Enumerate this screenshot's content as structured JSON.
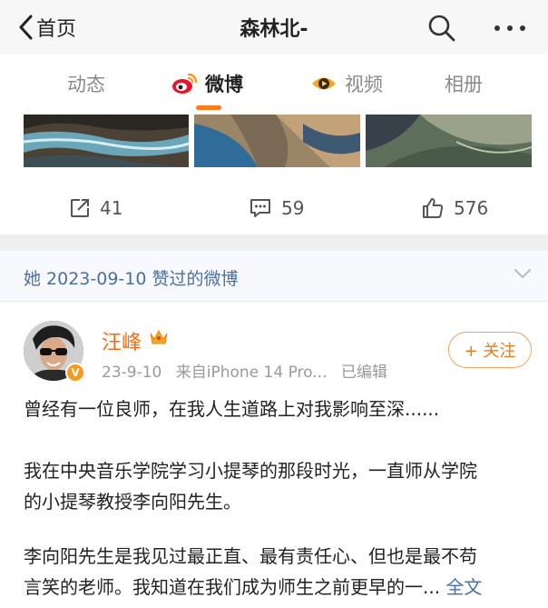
{
  "nav": {
    "back_label": "首页",
    "title": "森林北-"
  },
  "tabs": [
    {
      "label": "动态",
      "active": false
    },
    {
      "label": "微博",
      "active": true
    },
    {
      "label": "视频",
      "active": false
    },
    {
      "label": "相册",
      "active": false
    }
  ],
  "prev_post": {
    "repost_count": "41",
    "comment_count": "59",
    "like_count": "576"
  },
  "liked_header": "她 2023-09-10 赞过的微博",
  "post": {
    "username": "汪峰",
    "date": "23-9-10",
    "source": "来自iPhone 14 Pro...",
    "edited": "已编辑",
    "follow_label": "+ 关注",
    "lines": [
      "曾经有一位良师，在我人生道路上对我影响至深......",
      "我在中央音乐学院学习小提琴的那段时光，一直师从学院",
      "的小提琴教授李向阳先生。",
      "李向阳先生是我见过最正直、最有责任心、但也是最不苟",
      "言笑的老师。我知道在我们成为师生之前更早的一..."
    ],
    "full_text_label": "全文"
  },
  "colors": {
    "accent": "#ff7a1a",
    "username": "#f56e12",
    "link": "#4a6fa5"
  },
  "icons": {
    "back": "chevron-left-icon",
    "search": "search-icon",
    "more": "more-dots-icon",
    "weibo": "weibo-logo-icon",
    "video": "video-icon",
    "repost": "repost-icon",
    "comment": "comment-icon",
    "like": "thumbs-up-icon",
    "verified": "verified-badge-icon",
    "crown": "crown-icon",
    "expand": "chevron-down-icon"
  }
}
